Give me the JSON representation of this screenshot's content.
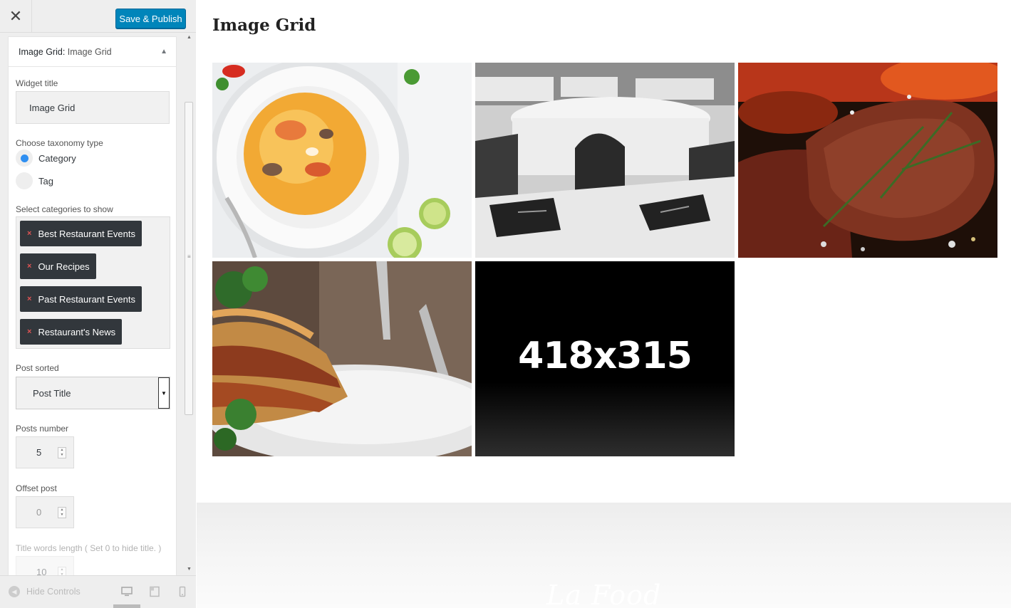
{
  "header": {
    "close_icon": "close-icon",
    "publish_label": "Save & Publish"
  },
  "widget": {
    "type_label": "Image Grid:",
    "name": "Image Grid",
    "title_label": "Widget title",
    "title_value": "Image Grid",
    "taxonomy_label": "Choose taxonomy type",
    "taxonomy_options": [
      {
        "label": "Category",
        "selected": true
      },
      {
        "label": "Tag",
        "selected": false
      }
    ],
    "categories_label": "Select categories to show",
    "categories": [
      "Best Restaurant Events",
      "Our Recipes",
      "Past Restaurant Events",
      "Restaurant's News"
    ],
    "sorted_label": "Post sorted",
    "sorted_value": "Post Title",
    "posts_number_label": "Posts number",
    "posts_number_value": "5",
    "offset_label": "Offset post",
    "offset_value": "0",
    "title_words_label": "Title words length ( Set 0 to hide title. )",
    "title_words_value": "10"
  },
  "footer": {
    "hide_controls_label": "Hide Controls",
    "device_icons": [
      "desktop-icon",
      "tablet-icon",
      "mobile-icon"
    ]
  },
  "preview": {
    "heading": "Image Grid",
    "tiles": [
      {
        "name": "soup-bowl-image"
      },
      {
        "name": "restaurant-tables-image"
      },
      {
        "name": "grilled-steak-image"
      },
      {
        "name": "lasagna-plate-image"
      },
      {
        "name": "placeholder-image",
        "text": "418x315"
      }
    ],
    "footer_logo": "La Food"
  },
  "colors": {
    "accent": "#0085ba",
    "chip_bg": "#32373c",
    "radio_on": "#2f8ff1"
  }
}
